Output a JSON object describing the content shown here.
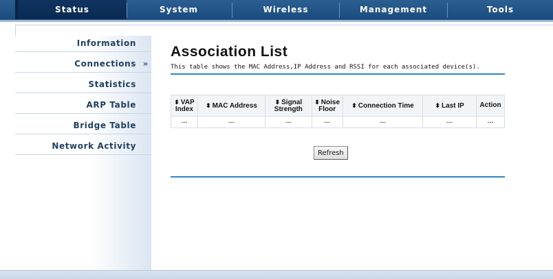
{
  "topnav": {
    "items": [
      {
        "label": "Status",
        "active": true
      },
      {
        "label": "System",
        "active": false
      },
      {
        "label": "Wireless",
        "active": false
      },
      {
        "label": "Management",
        "active": false
      },
      {
        "label": "Tools",
        "active": false
      }
    ]
  },
  "sidebar": {
    "items": [
      {
        "label": "Information"
      },
      {
        "label": "Connections",
        "marker": "»",
        "selected": true
      },
      {
        "label": "Statistics"
      },
      {
        "label": "ARP Table"
      },
      {
        "label": "Bridge Table"
      },
      {
        "label": "Network Activity"
      }
    ]
  },
  "main": {
    "title": "Association List",
    "description": "This table shows the MAC Address,IP Address and RSSI for each associated device(s).",
    "table": {
      "columns": [
        {
          "line1": "VAP",
          "line2": "Index",
          "sortable": true
        },
        {
          "line1": "MAC Address",
          "line2": "",
          "sortable": true
        },
        {
          "line1": "Signal",
          "line2": "Strength",
          "sortable": true
        },
        {
          "line1": "Noise",
          "line2": "Floor",
          "sortable": true
        },
        {
          "line1": "Connection Time",
          "line2": "",
          "sortable": true
        },
        {
          "line1": "Last IP",
          "line2": "",
          "sortable": true
        },
        {
          "line1": "Action",
          "line2": "",
          "sortable": false
        }
      ],
      "sort_glyph": "⬍",
      "rows": [
        [
          "---",
          "---",
          "---",
          "---",
          "---",
          "---",
          "---"
        ]
      ]
    },
    "refresh_label": "Refresh"
  },
  "colors": {
    "nav_bg": "#1b4b7d",
    "nav_active": "#0a2a52",
    "accent_line": "#2f85c2",
    "sidebar_text": "#1f3e5f"
  }
}
